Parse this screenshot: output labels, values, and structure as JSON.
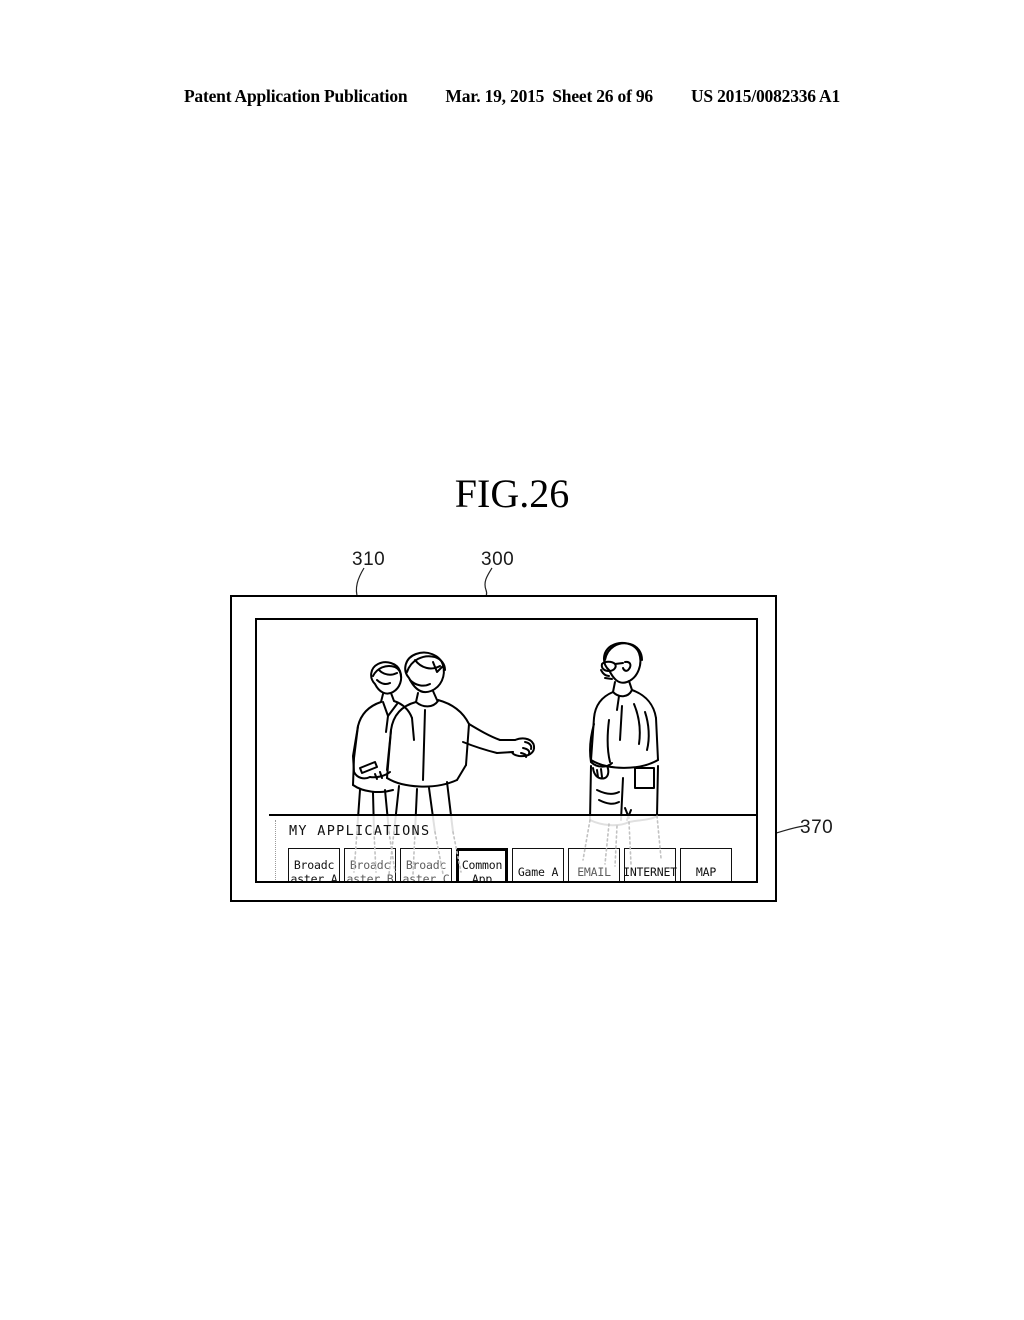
{
  "header": {
    "publication": "Patent Application Publication",
    "date": "Mar. 19, 2015",
    "sheet": "Sheet 26 of 96",
    "patent_number": "US 2015/0082336 A1"
  },
  "figure": {
    "title": "FIG.26",
    "reference_numerals": [
      {
        "id": "310",
        "label": "310",
        "points_to": "display-screen"
      },
      {
        "id": "300",
        "label": "300",
        "points_to": "display-device"
      },
      {
        "id": "370",
        "label": "370",
        "points_to": "application-bar"
      }
    ]
  },
  "display": {
    "video_content": {
      "description": "line-art scene of three standing people",
      "people": [
        {
          "name": "person-left-background",
          "pose": "standing, partially behind"
        },
        {
          "name": "person-left-foreground",
          "pose": "standing, right arm extended pointing right"
        },
        {
          "name": "person-right",
          "pose": "standing in profile facing left, wearing glasses"
        }
      ]
    },
    "app_bar": {
      "title": "MY APPLICATIONS",
      "tiles": [
        {
          "name": "broadcaster-a",
          "line1": "Broadc",
          "line2": "aster A",
          "selected": false,
          "faded": false
        },
        {
          "name": "broadcaster-b",
          "line1": "Broadc",
          "line2": "aster B",
          "selected": false,
          "faded": true
        },
        {
          "name": "broadcaster-c",
          "line1": "Broadc",
          "line2": "aster C",
          "selected": false,
          "faded": true
        },
        {
          "name": "common-app",
          "line1": "Common",
          "line2": "App",
          "selected": true,
          "faded": false
        },
        {
          "name": "game-a",
          "line1": "Game A",
          "line2": "",
          "selected": false,
          "faded": false
        },
        {
          "name": "email",
          "line1": "EMAIL",
          "line2": "",
          "selected": false,
          "faded": true
        },
        {
          "name": "internet",
          "line1": "INTERNET",
          "line2": "",
          "selected": false,
          "faded": false
        },
        {
          "name": "map",
          "line1": "MAP",
          "line2": "",
          "selected": false,
          "faded": false
        }
      ]
    }
  },
  "colors": {
    "ink": "#000000",
    "paper": "#ffffff",
    "ghost": "#bdbdbd",
    "dotted_border": "#9a9a9a"
  }
}
